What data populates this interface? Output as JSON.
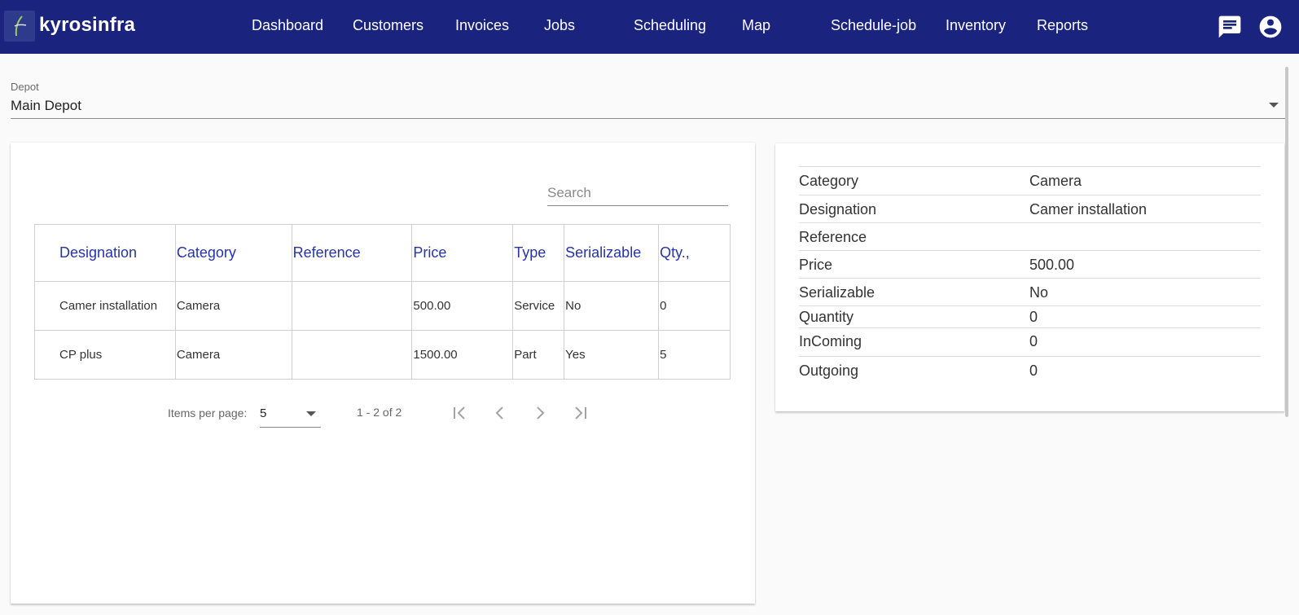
{
  "app": {
    "brand": "kyrosinfra"
  },
  "nav": {
    "items": [
      {
        "label": "Dashboard"
      },
      {
        "label": "Customers"
      },
      {
        "label": "Invoices"
      },
      {
        "label": "Jobs"
      },
      {
        "label": "Scheduling"
      },
      {
        "label": "Map"
      },
      {
        "label": "Schedule-job"
      },
      {
        "label": "Inventory"
      },
      {
        "label": "Reports"
      }
    ],
    "icons": [
      "chat-icon",
      "account-circle-icon"
    ]
  },
  "depot": {
    "label": "Depot",
    "value": "Main Depot"
  },
  "search": {
    "placeholder": "Search",
    "value": ""
  },
  "table": {
    "headers": [
      "Designation",
      "Category",
      "Reference",
      "Price",
      "Type",
      "Serializable",
      "Qty.,"
    ],
    "rows": [
      [
        "Camer installation",
        "Camera",
        "",
        "500.00",
        "Service",
        "No",
        "0"
      ],
      [
        "CP plus",
        "Camera",
        "",
        "1500.00",
        "Part",
        "Yes",
        "5"
      ]
    ]
  },
  "paginator": {
    "items_per_page_label": "Items per page:",
    "items_per_page": "5",
    "range": "1 - 2 of 2",
    "icons": [
      "first-page-icon",
      "previous-page-icon",
      "next-page-icon",
      "last-page-icon"
    ]
  },
  "details": {
    "rows": [
      {
        "label": "Category",
        "value": "Camera"
      },
      {
        "label": "Designation",
        "value": "Camer installation"
      },
      {
        "label": "Reference",
        "value": ""
      },
      {
        "label": "Price",
        "value": "500.00"
      },
      {
        "label": "Serializable",
        "value": "No"
      },
      {
        "label": "Quantity",
        "value": "0"
      },
      {
        "label": "InComing",
        "value": "0"
      },
      {
        "label": "Outgoing",
        "value": "0"
      }
    ]
  },
  "colors": {
    "header_bg": "#1a237e",
    "header_text": "#2634a6",
    "qty_text": "#2e9e2e"
  }
}
